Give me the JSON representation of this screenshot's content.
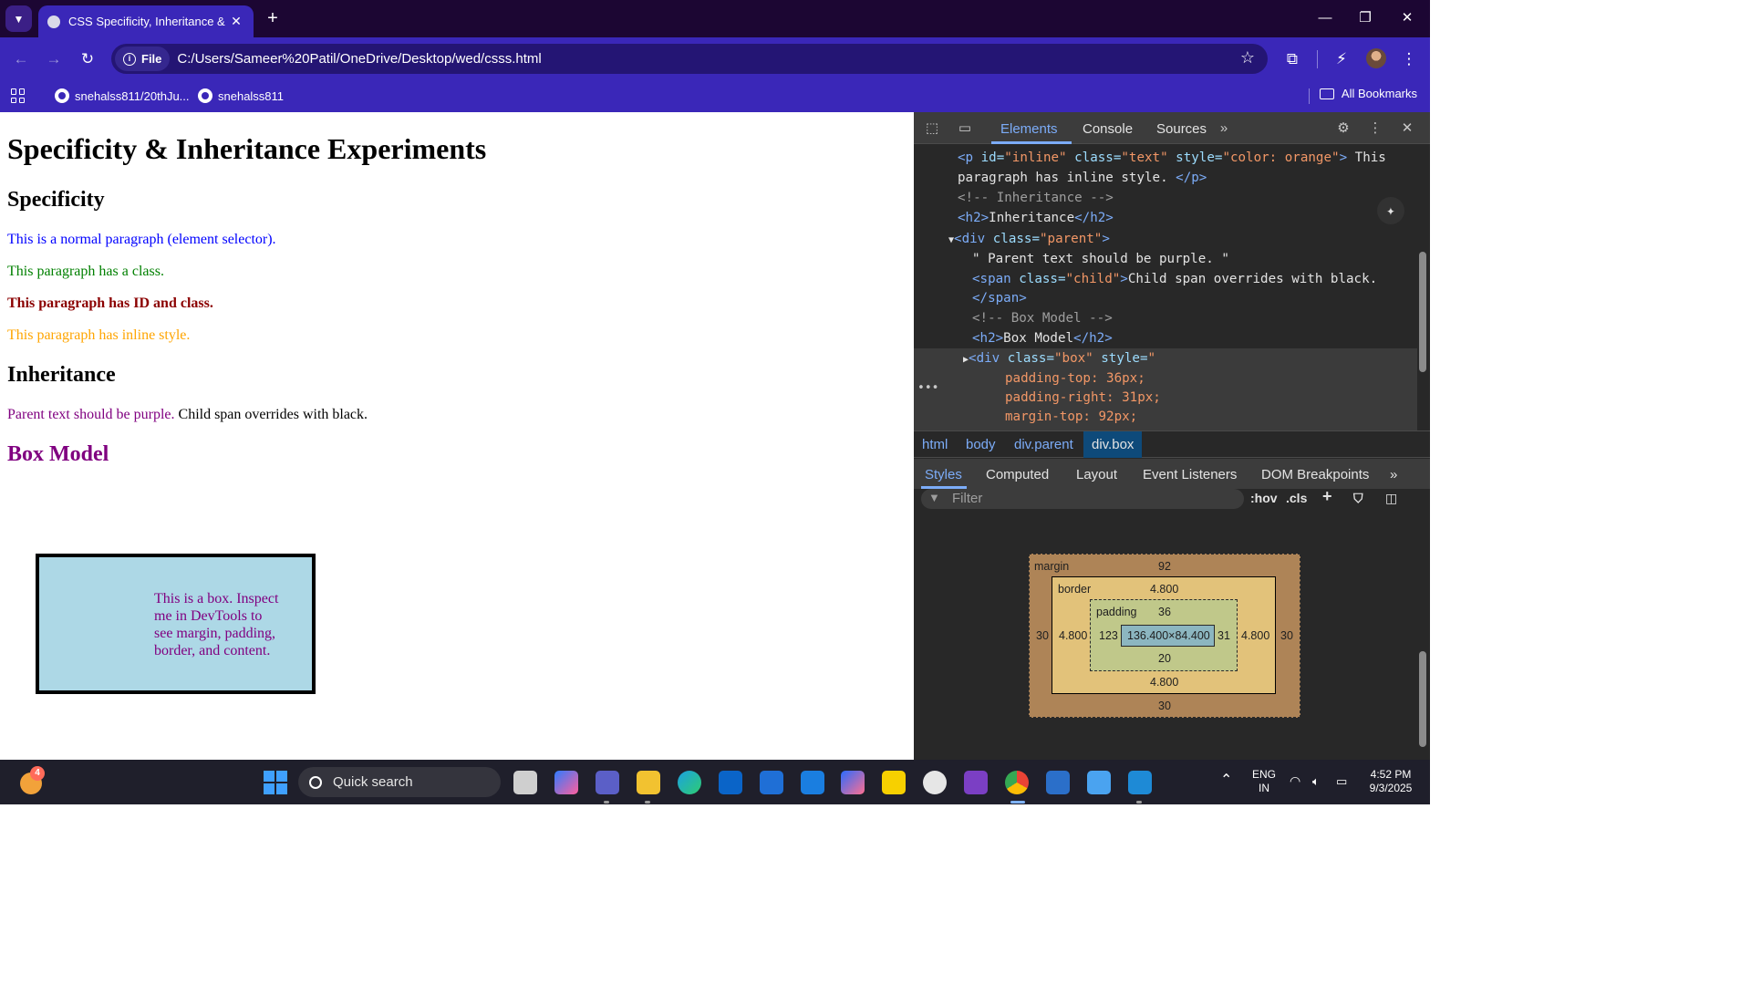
{
  "browser": {
    "tab_title": "CSS Specificity, Inheritance & B",
    "site_chip": "File",
    "url": "C:/Users/Sameer%20Patil/OneDrive/Desktop/wed/csss.html",
    "bookmarks": [
      "snehalss811/20thJu...",
      "snehalss811"
    ],
    "all_bookmarks": "All Bookmarks"
  },
  "page": {
    "h1": "Specificity & Inheritance Experiments",
    "h2_specificity": "Specificity",
    "p_normal": "This is a normal paragraph (element selector).",
    "p_class": "This paragraph has a class.",
    "p_id": "This paragraph has ID and class.",
    "p_inline": "This paragraph has inline style.",
    "h2_inheritance": "Inheritance",
    "parent_text": "Parent text should be purple. ",
    "child_text": "Child span overrides with black.",
    "h2_box": "Box Model",
    "box_text": "This is a box. Inspect me in DevTools to see margin, padding, border, and content.",
    "colors": {
      "normal": "#0000ff",
      "class": "#008000",
      "id": "#8b0000",
      "inline": "#ffa500",
      "parent": "#800080",
      "box_bg": "#add8e6"
    }
  },
  "devtools": {
    "tabs": [
      "Elements",
      "Console",
      "Sources"
    ],
    "active_tab": "Elements",
    "code": {
      "l1_tag_open": "<p ",
      "l1_attr_id": "id=",
      "l1_val_id": "\"inline\"",
      "l1_attr_class": " class=",
      "l1_val_class": "\"text\"",
      "l1_attr_style": " style=",
      "l1_val_style": "\"color: orange\"",
      "l1_close": ">",
      "l1_text": " This",
      "l2_text": "paragraph has inline style. ",
      "l2_end": "</p>",
      "l3_comment": "<!-- Inheritance -->",
      "l4_open": "<h2>",
      "l4_text": "Inheritance",
      "l4_close": "</h2>",
      "l5_open": "<div ",
      "l5_attr": "class=",
      "l5_val": "\"parent\"",
      "l5_close": ">",
      "l6_text": "\" Parent text should be purple. \"",
      "l7_open": "<span ",
      "l7_attr": "class=",
      "l7_val": "\"child\"",
      "l7_close": ">",
      "l7_text": "Child span overrides with black.",
      "l8_close": "</span>",
      "l9_comment": "<!-- Box Model -->",
      "l10_open": "<h2>",
      "l10_text": "Box Model",
      "l10_close": "</h2>",
      "l11_open": "<div ",
      "l11_attr1": "class=",
      "l11_val1": "\"box\"",
      "l11_attr2": " style=",
      "l11_val2": "\"",
      "l12": "padding-top: 36px;",
      "l13": "padding-right: 31px;",
      "l14": "margin-top: 92px;"
    },
    "breadcrumbs": [
      "html",
      "body",
      "div.parent",
      "div.box"
    ],
    "sub_tabs": [
      "Styles",
      "Computed",
      "Layout",
      "Event Listeners",
      "DOM Breakpoints"
    ],
    "filter_placeholder": "Filter",
    "hov": ":hov",
    "cls": ".cls",
    "box_model": {
      "margin_label": "margin",
      "margin_top": "92",
      "margin_right": "30",
      "margin_bottom": "30",
      "margin_left": "30",
      "border_label": "border",
      "border_top": "4.800",
      "border_right": "4.800",
      "border_bottom": "4.800",
      "border_left": "4.800",
      "padding_label": "padding",
      "padding_top": "36",
      "padding_right": "31",
      "padding_bottom": "20",
      "padding_left": "123",
      "content": "136.400×84.400"
    }
  },
  "taskbar": {
    "search": "Quick search",
    "weather_badge": "4",
    "lang_1": "ENG",
    "lang_2": "IN",
    "time": "4:52 PM",
    "date": "9/3/2025"
  }
}
